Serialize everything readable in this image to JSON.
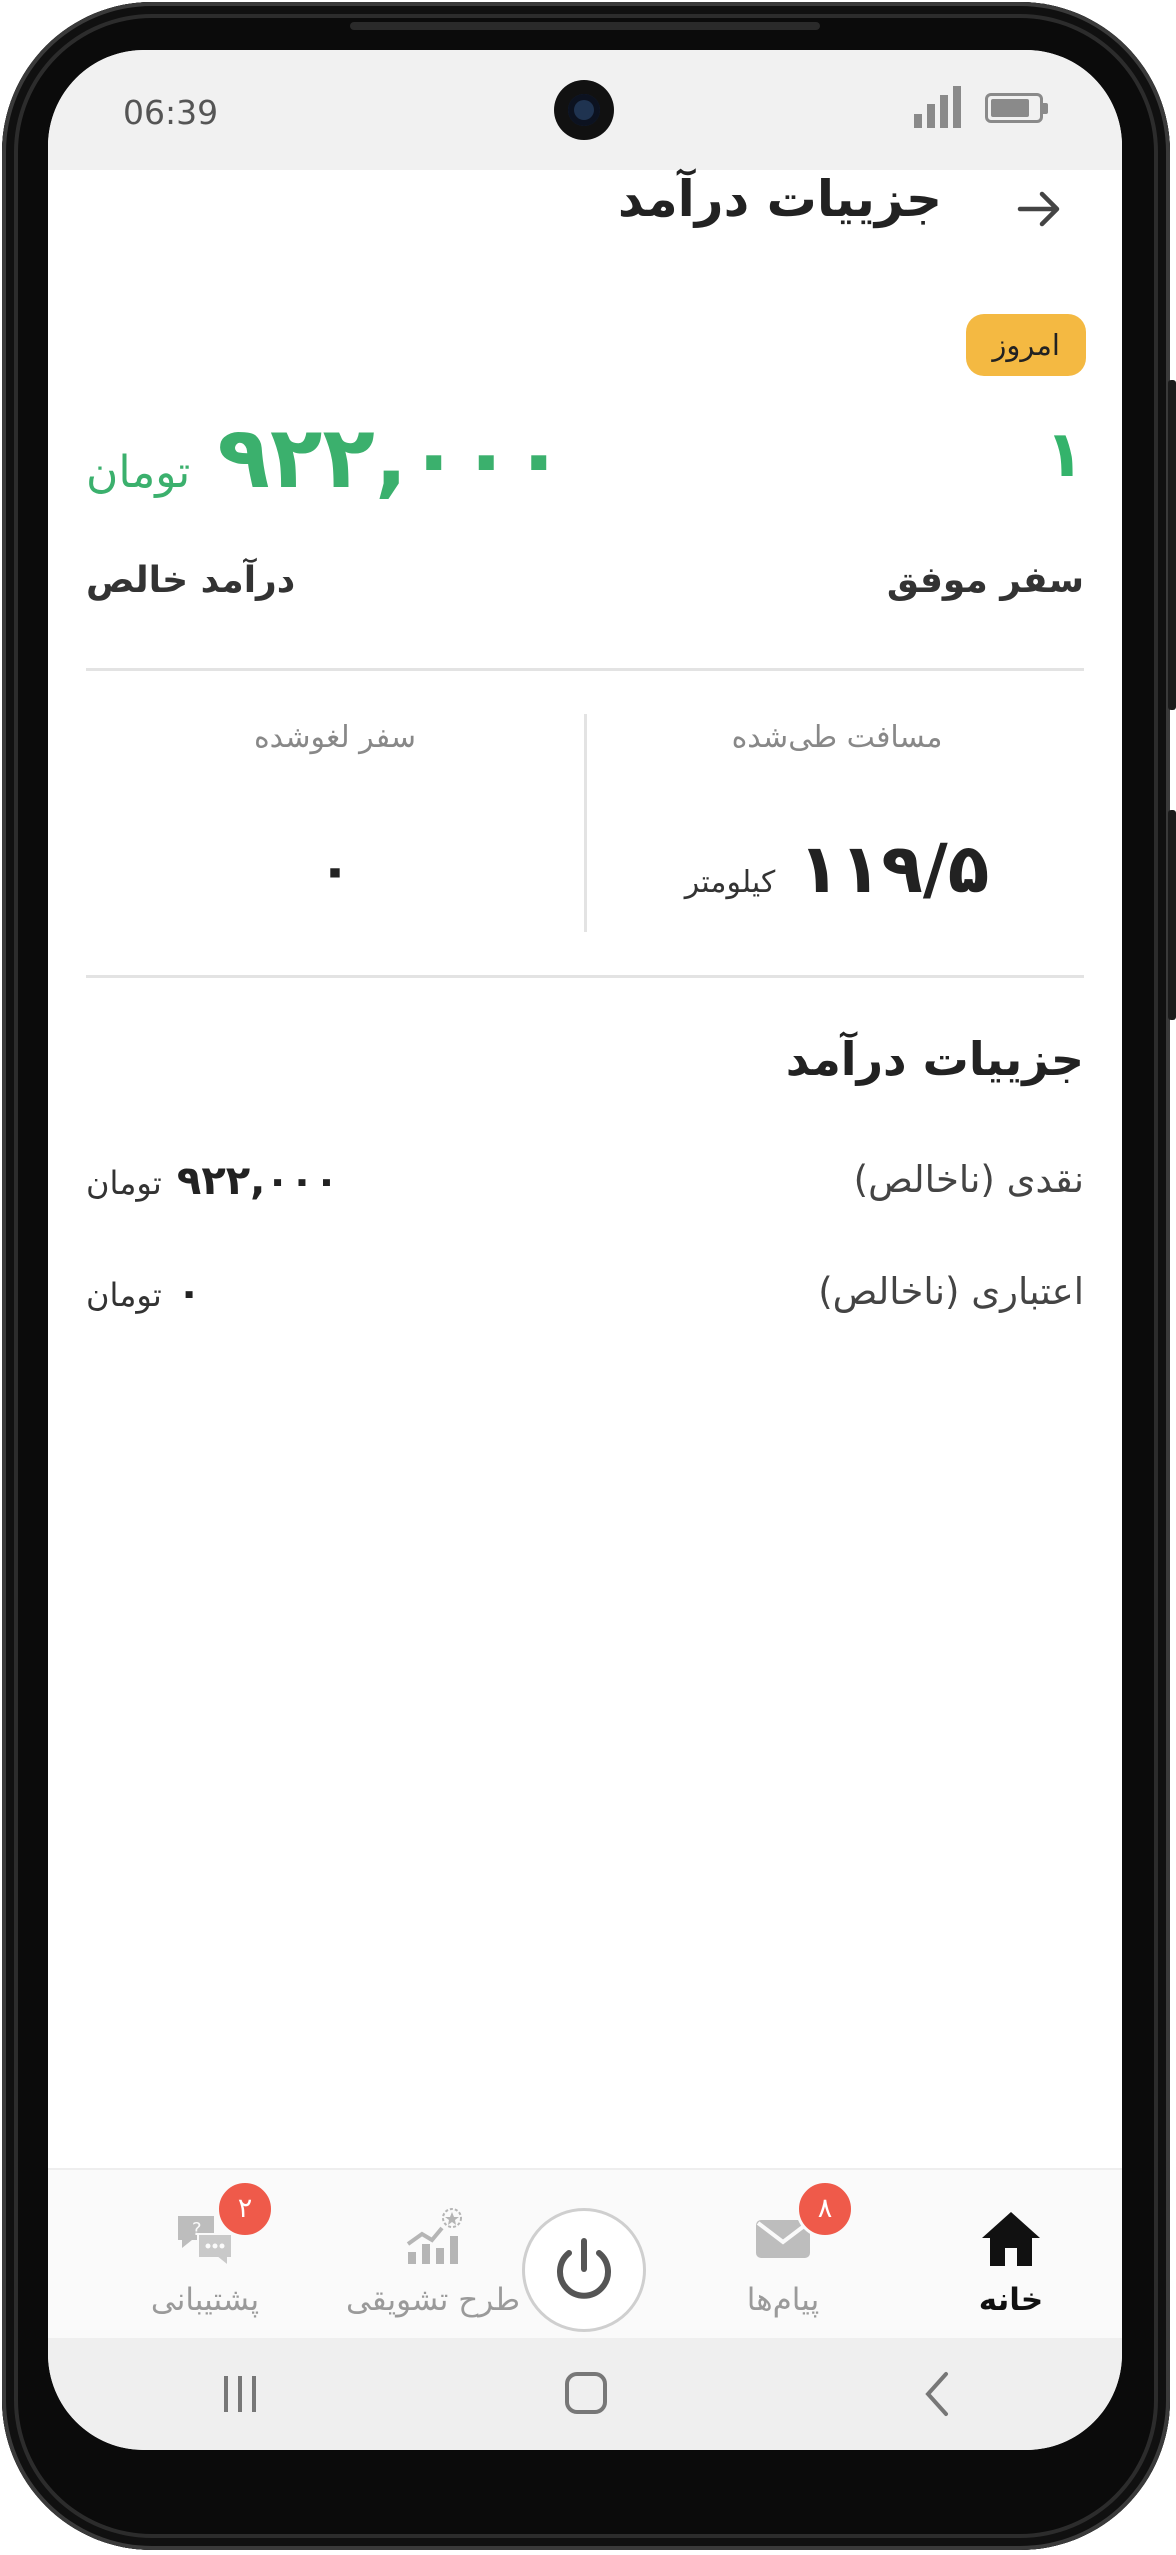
{
  "status_bar": {
    "time": "06:39"
  },
  "header": {
    "title": "جزییات درآمد",
    "back_icon": "arrow-right-icon"
  },
  "filter": {
    "today_label": "امروز",
    "accent": "#f4b942"
  },
  "summary": {
    "trip_count": "۱",
    "trip_label": "سفر موفق",
    "net_income_value": "۹۲۲,۰۰۰",
    "net_income_currency": "تومان",
    "net_income_label": "درآمد خالص",
    "income_color": "#3bb06d"
  },
  "stats": {
    "distance_label": "مسافت طی‌شده",
    "distance_value": "۱۱۹/۵",
    "distance_unit": "کیلومتر",
    "cancelled_label": "سفر لغوشده",
    "cancelled_value": "۰"
  },
  "details": {
    "title": "جزییات درآمد",
    "rows": [
      {
        "label": "نقدی (ناخالص)",
        "value": "۹۲۲,۰۰۰",
        "currency": "تومان"
      },
      {
        "label": "اعتباری (ناخالص)",
        "value": "۰",
        "currency": "تومان"
      }
    ]
  },
  "bottom_nav": {
    "items": [
      {
        "label": "خانه",
        "icon": "home-icon",
        "active": true
      },
      {
        "label": "پیام‌ها",
        "icon": "mail-icon",
        "badge": "۸"
      },
      {
        "label": "",
        "icon": "power-icon"
      },
      {
        "label": "طرح تشویقی",
        "icon": "incentive-chart-icon"
      },
      {
        "label": "پشتیبانی",
        "icon": "support-chat-icon",
        "badge": "۲"
      }
    ],
    "badge_color": "#ef5a4a"
  },
  "system_nav": {
    "icons": [
      "recent-apps-icon",
      "home-circle-icon",
      "back-chevron-icon"
    ]
  }
}
